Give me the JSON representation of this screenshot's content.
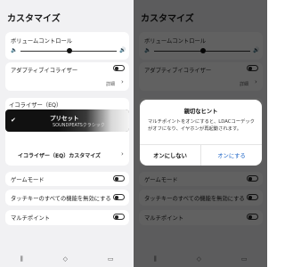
{
  "colors": {
    "background": "#f1f1f3",
    "card": "#ffffff",
    "accent": "#1b63c6",
    "overlay": "rgba(0,0,0,0.62)"
  },
  "page_title": "カスタマイズ",
  "volume": {
    "label": "ボリュームコントロール",
    "level": 0.55
  },
  "adaptive_eq": {
    "label": "アダプティブイコライザー",
    "details": "詳細"
  },
  "eq": {
    "label": "イコライザー（EQ）",
    "preset_title": "プリセット",
    "preset_sub": "SOUNDPEATSクラシック",
    "custom_label": "イコライザー（EQ）カスタマイズ"
  },
  "game_mode": {
    "label": "ゲームモード"
  },
  "touch_disable": {
    "label": "タッチキーのすべての機能を無効にする"
  },
  "multipoint": {
    "label": "マルチポイント"
  },
  "dialog": {
    "title": "親切なヒント",
    "message": "マルチポイントをオンにすると、LDACコーデックがオフになり、イヤホンが再起動されます。",
    "cancel": "オンにしない",
    "confirm": "オンにする"
  },
  "nav": {
    "home_icon": "equalizer-icon",
    "middle_icon": "diamond-icon",
    "right_icon": "device-icon"
  }
}
